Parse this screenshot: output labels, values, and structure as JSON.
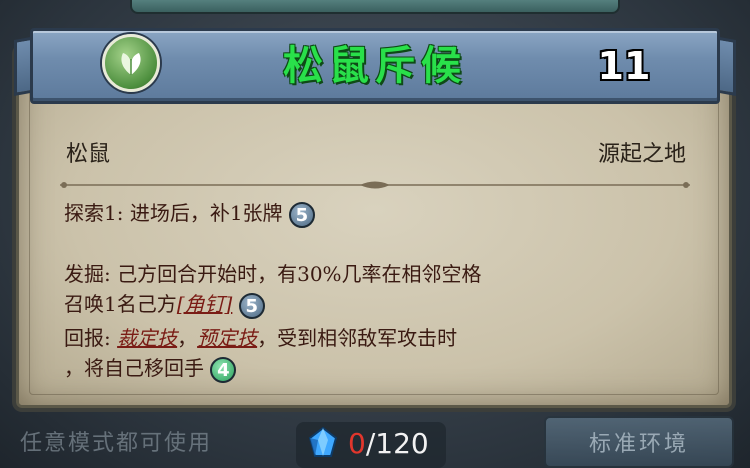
{
  "card": {
    "name": "松鼠斥候",
    "cost": "11",
    "faction_icon": "leaf-icon",
    "type": "松鼠",
    "origin": "源起之地",
    "abilities": [
      {
        "label": "探索1:",
        "text": "进场后，补1张牌",
        "badge": "5",
        "badge_color": "#4e6b85"
      },
      {
        "label": "发掘:",
        "text_line1": "己方回合开始时，有30%几率在相邻空格",
        "text_line2_prefix": "召唤1名己方",
        "keyword": "[角钉]",
        "badge": "5",
        "badge_color": "#4e6b85"
      },
      {
        "label": "回报:",
        "keyword1": "裁定技",
        "sep1": "，",
        "keyword2": "预定技",
        "text_line1_suffix": "，受到相邻敌军攻击时",
        "text_line2": "，将自己移回手",
        "badge": "4",
        "badge_color": "#2ba15d"
      }
    ]
  },
  "footer": {
    "left_text": "任意模式都可使用",
    "right_button": "标准环境",
    "currency_icon": "crystal-icon",
    "currency_current": "0",
    "currency_max": "/120"
  },
  "colors": {
    "title": "#29e04a",
    "banner": "#6f8cad",
    "text": "#3a1a12",
    "currency_current": "#e2362c"
  }
}
